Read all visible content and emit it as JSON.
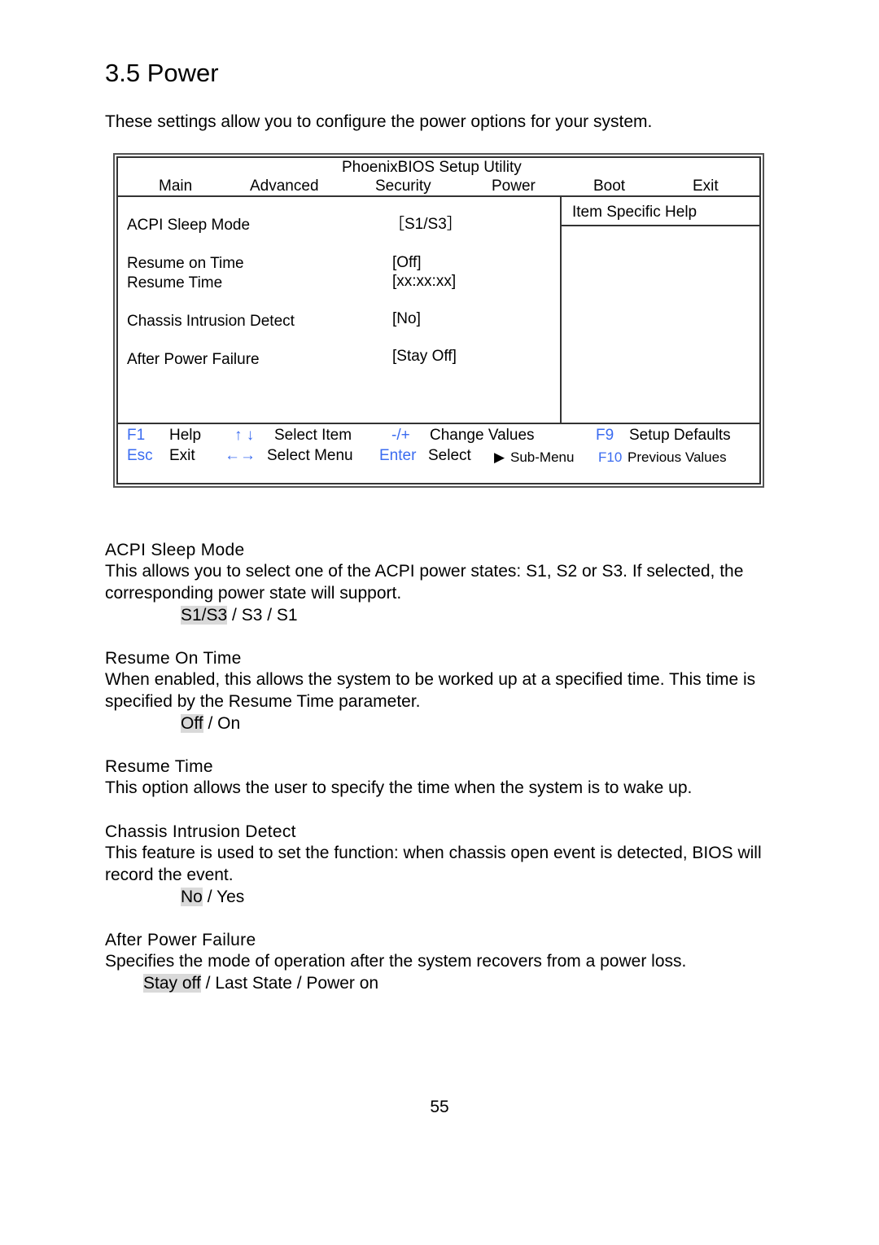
{
  "page": {
    "title": "3.5 Power",
    "intro": "These settings allow you to configure the power options for your system.",
    "page_number": "55"
  },
  "bios": {
    "utility_title": "PhoenixBIOS Setup Utility",
    "menu": [
      "Main",
      "Advanced",
      "Security",
      "Power",
      "Boot",
      "Exit"
    ],
    "active_menu": "Power",
    "settings": [
      {
        "label": "ACPI Sleep Mode",
        "value": "［S1/S3］"
      },
      {
        "label": "Resume on Time",
        "value": "[Off]"
      },
      {
        "label": "Resume Time",
        "value": "[xx:xx:xx]"
      },
      {
        "label": "Chassis Intrusion Detect",
        "value": "[No]"
      },
      {
        "label": "After Power Failure",
        "value": "[Stay Off]"
      }
    ],
    "help_title": "Item Specific Help",
    "keys": {
      "f1": "F1",
      "help": "Help",
      "updown_icon": "↑ ↓",
      "select_item": "Select Item",
      "minusplus": "-/+",
      "change_values": "Change Values",
      "f9": "F9",
      "setup_defaults": "Setup Defaults",
      "esc": "Esc",
      "exit": "Exit",
      "leftright_icon": "←→",
      "select_menu": "Select Menu",
      "enter": "Enter",
      "select": "Select",
      "submenu_icon": "▶",
      "submenu": "Sub-Menu",
      "f10": "F10",
      "previous_values": "Previous Values"
    },
    "key_color": "#3b6cf0"
  },
  "descriptions": [
    {
      "heading": "ACPI Sleep Mode",
      "text": "This allows you to select one of the ACPI power states: S1, S2 or S3. If selected, the corresponding power state will support.",
      "default": "S1/S3",
      "rest": " / S3 / S1"
    },
    {
      "heading": "Resume On Time",
      "text": "When enabled, this allows the system to be worked up at a specified time. This time is specified by the Resume Time parameter.",
      "default": "Off",
      "rest": " / On"
    },
    {
      "heading": "Resume Time",
      "text": "This option allows the user to specify the time when the system is to wake up."
    },
    {
      "heading": "Chassis Intrusion Detect",
      "text": "This feature is used to set the function: when chassis open event is detected, BIOS will record the event.",
      "default": "No",
      "rest": " / Yes"
    },
    {
      "heading": "After Power Failure",
      "text": "Specifies the mode of operation after the system recovers from a power loss.",
      "default": "Stay off",
      "rest": " / Last State / Power on"
    }
  ]
}
